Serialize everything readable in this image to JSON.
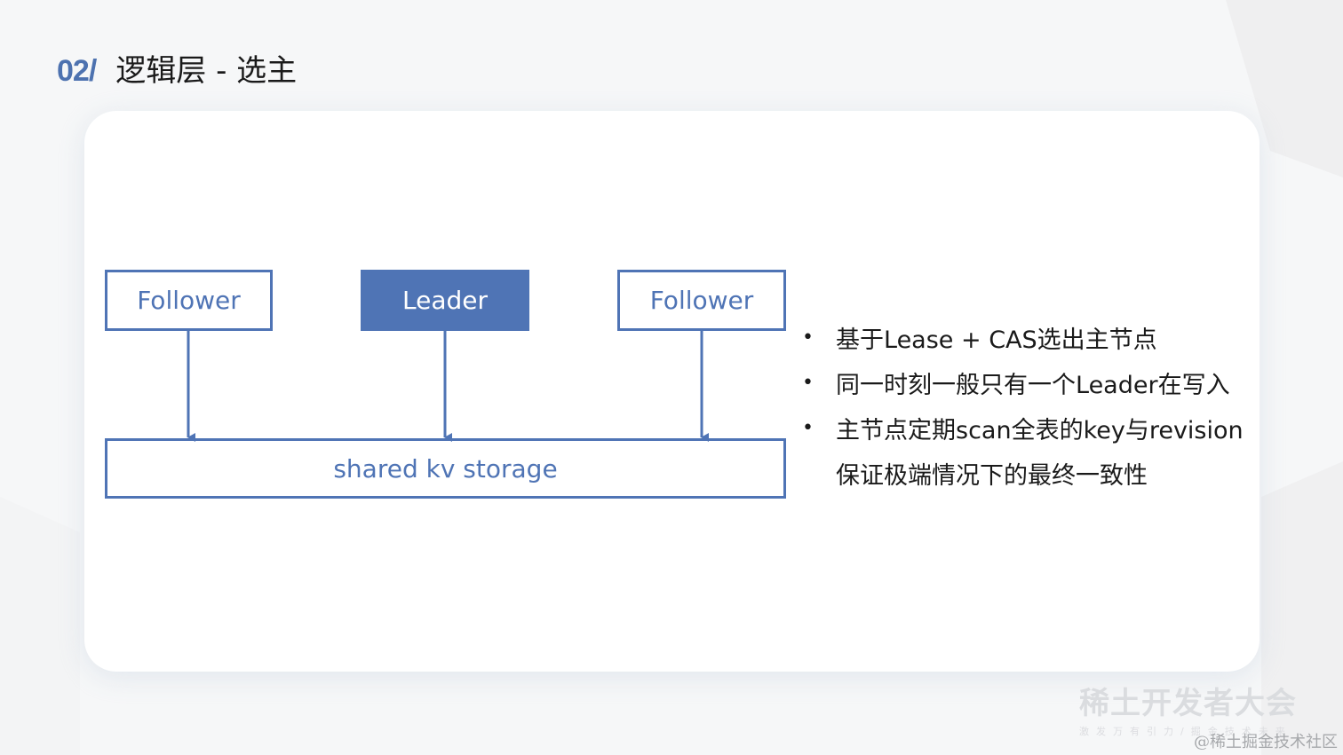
{
  "slide": {
    "number": "02/",
    "title": "逻辑层 - 选主"
  },
  "diagram": {
    "nodes": [
      {
        "id": "follower-left",
        "label": "Follower",
        "role": "follower"
      },
      {
        "id": "leader",
        "label": "Leader",
        "role": "leader"
      },
      {
        "id": "follower-right",
        "label": "Follower",
        "role": "follower"
      }
    ],
    "storage": {
      "label": "shared kv storage"
    },
    "edges": [
      {
        "from": "follower-left",
        "to": "storage"
      },
      {
        "from": "leader",
        "to": "storage"
      },
      {
        "from": "follower-right",
        "to": "storage"
      }
    ],
    "colors": {
      "accent": "#4f74b5",
      "leader_text": "#ffffff"
    }
  },
  "bullets": {
    "dot": "•",
    "items": [
      {
        "text": "基于Lease + CAS选出主节点"
      },
      {
        "text": "同一时刻一般只有一个Leader在写入"
      },
      {
        "text": "主节点定期scan全表的key与revision",
        "continuation": "保证极端情况下的最终一致性"
      }
    ]
  },
  "watermark": {
    "main": "稀土开发者大会",
    "sub": "激发万有引力/掘金技术未来",
    "credit": "@稀土掘金技术社区"
  }
}
